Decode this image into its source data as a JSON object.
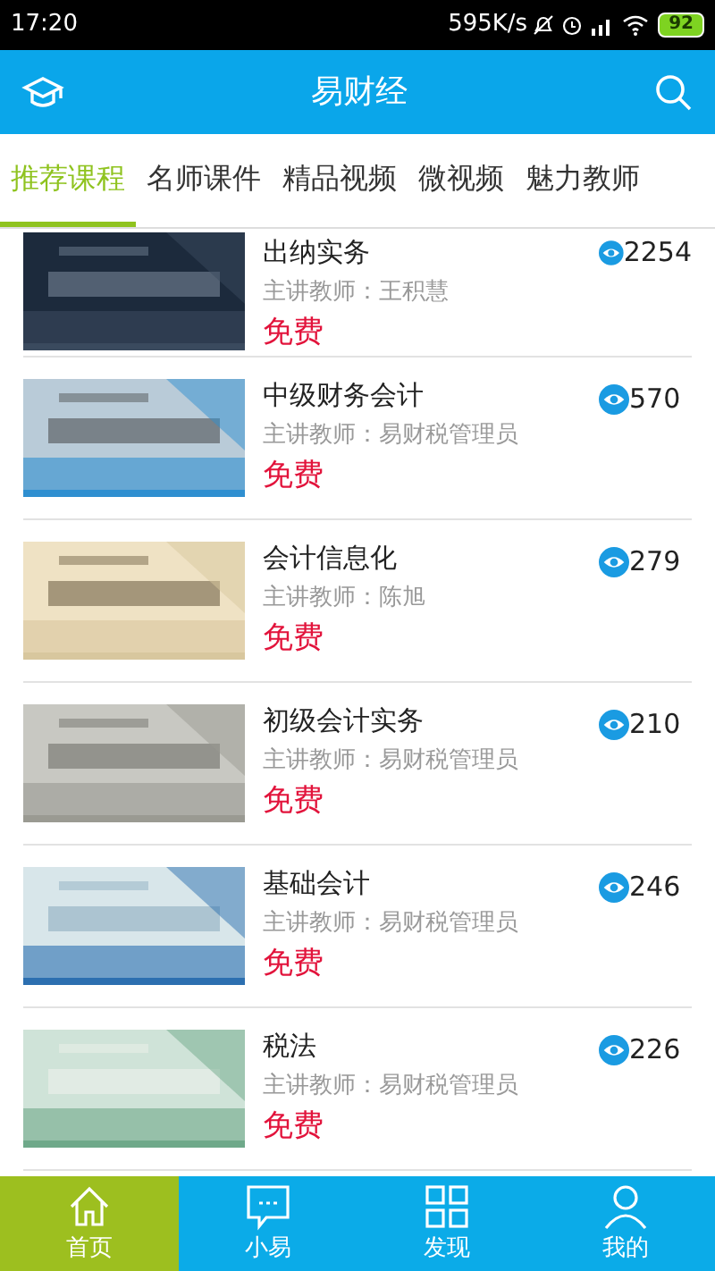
{
  "status_bar": {
    "time": "17:20",
    "speed": "595K/s",
    "battery": "92"
  },
  "header": {
    "title": "易财经"
  },
  "tabs": [
    {
      "label": "推荐课程",
      "selected": true
    },
    {
      "label": "名师课件",
      "selected": false
    },
    {
      "label": "精品视频",
      "selected": false
    },
    {
      "label": "微视频",
      "selected": false
    },
    {
      "label": "魅力教师",
      "selected": false
    }
  ],
  "courses": [
    {
      "title": "出纳实务",
      "teacher": "主讲教师：王积慧",
      "price": "免费",
      "views": "2254"
    },
    {
      "title": "中级财务会计",
      "teacher": "主讲教师：易财税管理员",
      "price": "免费",
      "views": "570"
    },
    {
      "title": "会计信息化",
      "teacher": "主讲教师：陈旭",
      "price": "免费",
      "views": "279"
    },
    {
      "title": "初级会计实务",
      "teacher": "主讲教师：易财税管理员",
      "price": "免费",
      "views": "210"
    },
    {
      "title": "基础会计",
      "teacher": "主讲教师：易财税管理员",
      "price": "免费",
      "views": "246"
    },
    {
      "title": "税法",
      "teacher": "主讲教师：易财税管理员",
      "price": "免费",
      "views": "226"
    }
  ],
  "bottom_nav": [
    {
      "label": "首页",
      "selected": true
    },
    {
      "label": "小易",
      "selected": false
    },
    {
      "label": "发现",
      "selected": false
    },
    {
      "label": "我的",
      "selected": false
    }
  ]
}
